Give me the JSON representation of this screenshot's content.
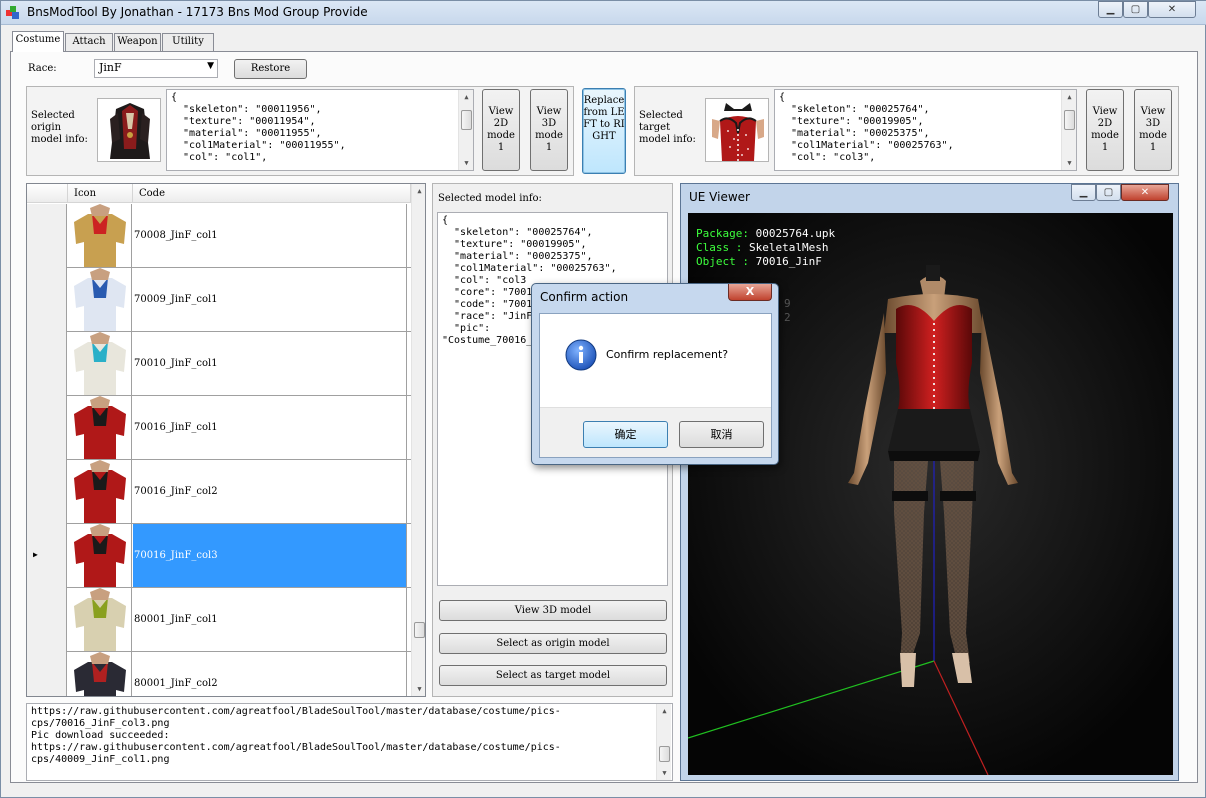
{
  "window": {
    "title": "BnsModTool By Jonathan - 17173 Bns Mod Group Provide",
    "min_glyph": "▁",
    "max_glyph": "▢",
    "close_glyph": "✕"
  },
  "tabs": [
    {
      "label": "Costume",
      "active": true
    },
    {
      "label": "Attach",
      "active": false
    },
    {
      "label": "Weapon",
      "active": false
    },
    {
      "label": "Utility",
      "active": false
    }
  ],
  "race": {
    "label": "Race:",
    "value": "JinF",
    "restore_label": "Restore"
  },
  "origin": {
    "label": "Selected origin model info:",
    "info": "{\n  \"skeleton\": \"00011956\",\n  \"texture\": \"00011954\",\n  \"material\": \"00011955\",\n  \"col1Material\": \"00011955\",\n  \"col\": \"col1\",",
    "view2d_label": "View 2D mode 1",
    "view3d_label": "View 3D mode 1"
  },
  "replace_button_label": "Replace from LEFT to RIGHT",
  "target": {
    "label": "Selected target model info:",
    "info": "{\n  \"skeleton\": \"00025764\",\n  \"texture\": \"00019905\",\n  \"material\": \"00025375\",\n  \"col1Material\": \"00025763\",\n  \"col\": \"col3\",",
    "view2d_label": "View 2D mode 1",
    "view3d_label": "View 3D mode 1"
  },
  "grid": {
    "headers": {
      "icon": "Icon",
      "code": "Code"
    },
    "rows": [
      {
        "code": "70008_JinF_col1",
        "color": "#c8a050",
        "accent": "#cc2222"
      },
      {
        "code": "70009_JinF_col1",
        "color": "#dfe6f2",
        "accent": "#2a5bb0"
      },
      {
        "code": "70010_JinF_col1",
        "color": "#e8e6dc",
        "accent": "#2ab0c8"
      },
      {
        "code": "70016_JinF_col1",
        "color": "#b01818",
        "accent": "#1a1a1a"
      },
      {
        "code": "70016_JinF_col2",
        "color": "#b01818",
        "accent": "#1a1a1a"
      },
      {
        "code": "70016_JinF_col3",
        "color": "#b01818",
        "accent": "#1a1a1a",
        "selected": true
      },
      {
        "code": "80001_JinF_col1",
        "color": "#d8d0b0",
        "accent": "#8aa020"
      },
      {
        "code": "80001_JinF_col2",
        "color": "#2a2a34",
        "accent": "#b02020"
      }
    ]
  },
  "selected_info": {
    "label": "Selected model info:",
    "text": "{\n  \"skeleton\": \"00025764\",\n  \"texture\": \"00019905\",\n  \"material\": \"00025375\",\n  \"col1Material\": \"00025763\",\n  \"col\": \"col3\n  \"core\": \"7001\n  \"code\": \"7001\n  \"race\": \"JinF\n  \"pic\":\n\"Costume_70016_",
    "view3d_label": "View 3D model",
    "origin_label": "Select as origin model",
    "target_label": "Select as target model"
  },
  "log": {
    "text": "https://raw.githubusercontent.com/agreatfool/BladeSoulTool/master/database/costume/pics-\ncps/70016_JinF_col3.png\nPic download succeeded:\nhttps://raw.githubusercontent.com/agreatfool/BladeSoulTool/master/database/costume/pics-\ncps/40009_JinF_col1.png"
  },
  "ue_viewer": {
    "title": "UE Viewer",
    "package_key": "Package:",
    "package_val": "00025764.upk",
    "class_key": "Class  :",
    "class_val": "SkeletalMesh",
    "object_key": "Object :",
    "object_val": "70016_JinF",
    "faint_1": "9",
    "faint_2": "2"
  },
  "dialog": {
    "title": "Confirm action",
    "close_glyph": "X",
    "message": "Confirm replacement?",
    "ok_label": "确定",
    "cancel_label": "取消"
  }
}
